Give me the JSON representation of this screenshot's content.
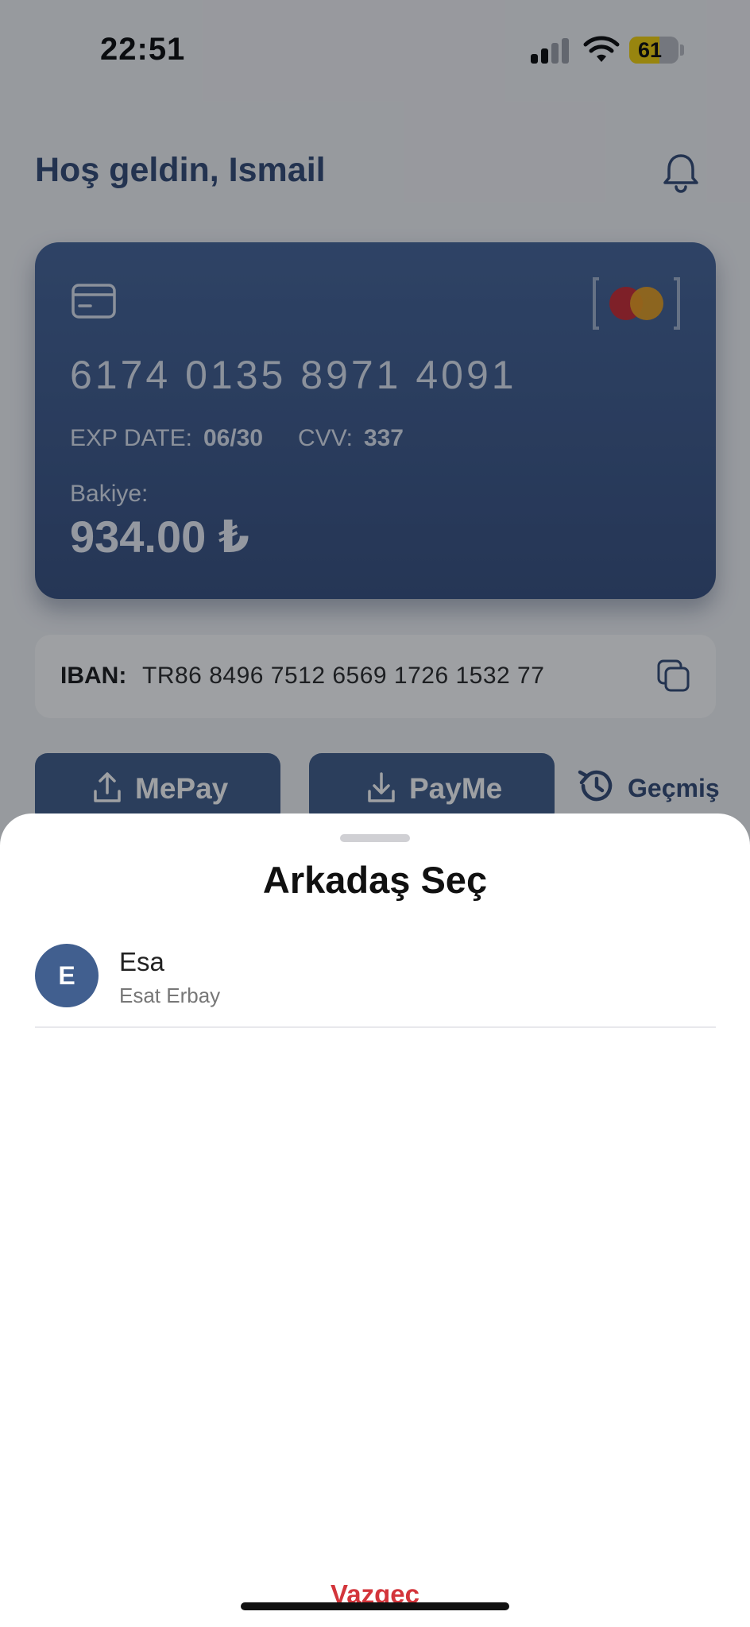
{
  "status_bar": {
    "time": "22:51",
    "battery_percent": "61",
    "battery_level": 0.61
  },
  "header": {
    "greeting": "Hoş geldin, Ismail"
  },
  "card": {
    "number": "6174 0135 8971 4091",
    "exp_label": "EXP DATE:",
    "exp_value": "06/30",
    "cvv_label": "CVV:",
    "cvv_value": "337",
    "balance_label": "Bakiye:",
    "balance_value": "934.00 ₺",
    "gradient_top": "#3f5f95",
    "gradient_bottom": "#30497a"
  },
  "iban": {
    "label": "IBAN:",
    "value": "TR86 8496 7512 6569 1726 1532 77"
  },
  "actions": {
    "mepay_label": "MePay",
    "payme_label": "PayMe",
    "history_label": "Geçmiş"
  },
  "sheet": {
    "title": "Arkadaş Seç",
    "friends": [
      {
        "initial": "E",
        "name": "Esa",
        "full_name": "Esat Erbay"
      }
    ],
    "cancel_label": "Vazgeç"
  },
  "colors": {
    "primary": "#3a5686",
    "cancel": "#d3353b"
  }
}
